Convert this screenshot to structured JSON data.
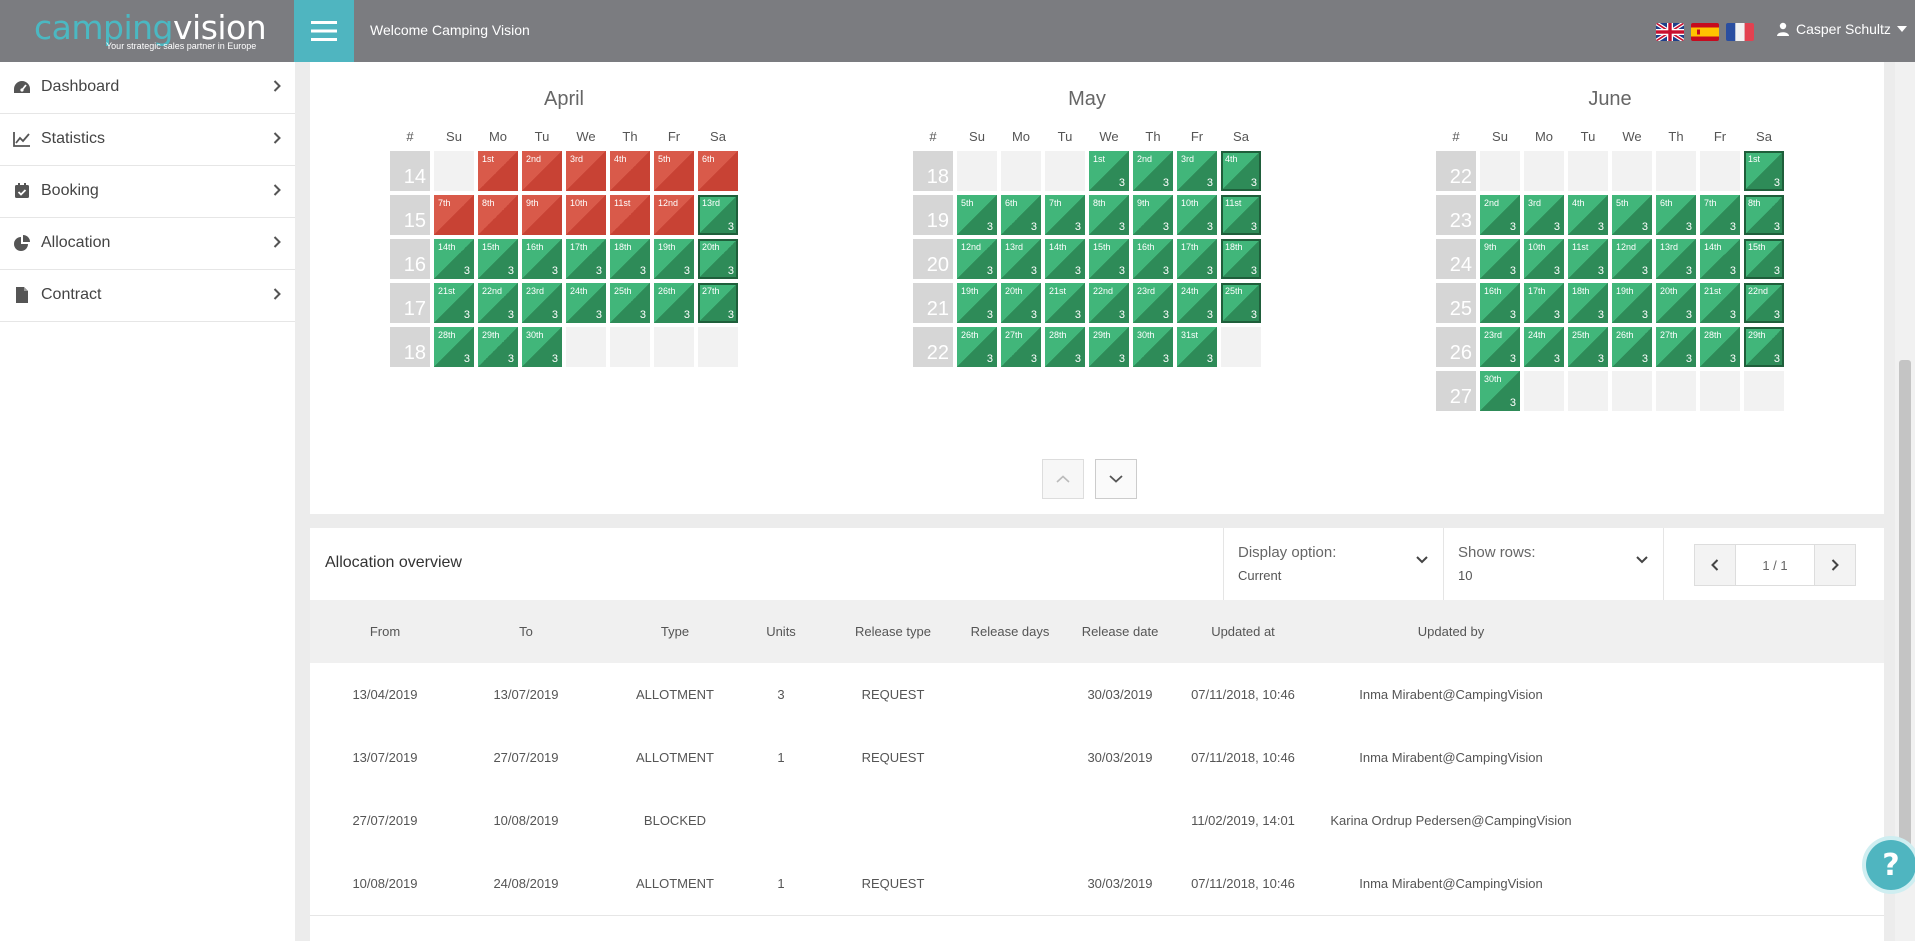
{
  "brand": {
    "name_part1": "camping",
    "name_part2": "vision",
    "tagline": "Your strategic sales partner in Europe"
  },
  "header": {
    "welcome": "Welcome Camping Vision",
    "user_name": "Casper Schultz",
    "flags": [
      "uk-flag",
      "spain-flag",
      "france-flag"
    ]
  },
  "sidebar": {
    "items": [
      {
        "label": "Dashboard",
        "icon": "dashboard-icon"
      },
      {
        "label": "Statistics",
        "icon": "chart-icon"
      },
      {
        "label": "Booking",
        "icon": "calendar-check-icon"
      },
      {
        "label": "Allocation",
        "icon": "pie-chart-icon"
      },
      {
        "label": "Contract",
        "icon": "file-icon"
      }
    ]
  },
  "calendar": {
    "weekday_labels": [
      "#",
      "Su",
      "Mo",
      "Tu",
      "We",
      "Th",
      "Fr",
      "Sa"
    ],
    "colors": {
      "available": "#41b67a",
      "unavailable": "#d95a4a",
      "empty": "#f2f2f2",
      "week": "#d6d6d6"
    },
    "months": [
      {
        "name": "April",
        "weeks": [
          {
            "num": "14",
            "days": [
              null,
              {
                "l": "1st",
                "s": "r"
              },
              {
                "l": "2nd",
                "s": "r"
              },
              {
                "l": "3rd",
                "s": "r"
              },
              {
                "l": "4th",
                "s": "r"
              },
              {
                "l": "5th",
                "s": "r"
              },
              {
                "l": "6th",
                "s": "r"
              }
            ]
          },
          {
            "num": "15",
            "days": [
              {
                "l": "7th",
                "s": "r"
              },
              {
                "l": "8th",
                "s": "r"
              },
              {
                "l": "9th",
                "s": "r"
              },
              {
                "l": "10th",
                "s": "r"
              },
              {
                "l": "11st",
                "s": "r"
              },
              {
                "l": "12nd",
                "s": "r"
              },
              {
                "l": "13rd",
                "s": "g",
                "u": "3"
              }
            ]
          },
          {
            "num": "16",
            "days": [
              {
                "l": "14th",
                "s": "g",
                "u": "3"
              },
              {
                "l": "15th",
                "s": "g",
                "u": "3"
              },
              {
                "l": "16th",
                "s": "g",
                "u": "3"
              },
              {
                "l": "17th",
                "s": "g",
                "u": "3"
              },
              {
                "l": "18th",
                "s": "g",
                "u": "3"
              },
              {
                "l": "19th",
                "s": "g",
                "u": "3"
              },
              {
                "l": "20th",
                "s": "g",
                "u": "3"
              }
            ]
          },
          {
            "num": "17",
            "days": [
              {
                "l": "21st",
                "s": "g",
                "u": "3"
              },
              {
                "l": "22nd",
                "s": "g",
                "u": "3"
              },
              {
                "l": "23rd",
                "s": "g",
                "u": "3"
              },
              {
                "l": "24th",
                "s": "g",
                "u": "3"
              },
              {
                "l": "25th",
                "s": "g",
                "u": "3"
              },
              {
                "l": "26th",
                "s": "g",
                "u": "3"
              },
              {
                "l": "27th",
                "s": "g",
                "u": "3"
              }
            ]
          },
          {
            "num": "18",
            "days": [
              {
                "l": "28th",
                "s": "g",
                "u": "3"
              },
              {
                "l": "29th",
                "s": "g",
                "u": "3"
              },
              {
                "l": "30th",
                "s": "g",
                "u": "3"
              },
              null,
              null,
              null,
              null
            ]
          }
        ]
      },
      {
        "name": "May",
        "weeks": [
          {
            "num": "18",
            "days": [
              null,
              null,
              null,
              {
                "l": "1st",
                "s": "g",
                "u": "3"
              },
              {
                "l": "2nd",
                "s": "g",
                "u": "3"
              },
              {
                "l": "3rd",
                "s": "g",
                "u": "3"
              },
              {
                "l": "4th",
                "s": "g",
                "u": "3"
              }
            ]
          },
          {
            "num": "19",
            "days": [
              {
                "l": "5th",
                "s": "g",
                "u": "3"
              },
              {
                "l": "6th",
                "s": "g",
                "u": "3"
              },
              {
                "l": "7th",
                "s": "g",
                "u": "3"
              },
              {
                "l": "8th",
                "s": "g",
                "u": "3"
              },
              {
                "l": "9th",
                "s": "g",
                "u": "3"
              },
              {
                "l": "10th",
                "s": "g",
                "u": "3"
              },
              {
                "l": "11st",
                "s": "g",
                "u": "3"
              }
            ]
          },
          {
            "num": "20",
            "days": [
              {
                "l": "12nd",
                "s": "g",
                "u": "3"
              },
              {
                "l": "13rd",
                "s": "g",
                "u": "3"
              },
              {
                "l": "14th",
                "s": "g",
                "u": "3"
              },
              {
                "l": "15th",
                "s": "g",
                "u": "3"
              },
              {
                "l": "16th",
                "s": "g",
                "u": "3"
              },
              {
                "l": "17th",
                "s": "g",
                "u": "3"
              },
              {
                "l": "18th",
                "s": "g",
                "u": "3"
              }
            ]
          },
          {
            "num": "21",
            "days": [
              {
                "l": "19th",
                "s": "g",
                "u": "3"
              },
              {
                "l": "20th",
                "s": "g",
                "u": "3"
              },
              {
                "l": "21st",
                "s": "g",
                "u": "3"
              },
              {
                "l": "22nd",
                "s": "g",
                "u": "3"
              },
              {
                "l": "23rd",
                "s": "g",
                "u": "3"
              },
              {
                "l": "24th",
                "s": "g",
                "u": "3"
              },
              {
                "l": "25th",
                "s": "g",
                "u": "3"
              }
            ]
          },
          {
            "num": "22",
            "days": [
              {
                "l": "26th",
                "s": "g",
                "u": "3"
              },
              {
                "l": "27th",
                "s": "g",
                "u": "3"
              },
              {
                "l": "28th",
                "s": "g",
                "u": "3"
              },
              {
                "l": "29th",
                "s": "g",
                "u": "3"
              },
              {
                "l": "30th",
                "s": "g",
                "u": "3"
              },
              {
                "l": "31st",
                "s": "g",
                "u": "3"
              },
              null
            ]
          }
        ]
      },
      {
        "name": "June",
        "weeks": [
          {
            "num": "22",
            "days": [
              null,
              null,
              null,
              null,
              null,
              null,
              {
                "l": "1st",
                "s": "g",
                "u": "3"
              }
            ]
          },
          {
            "num": "23",
            "days": [
              {
                "l": "2nd",
                "s": "g",
                "u": "3"
              },
              {
                "l": "3rd",
                "s": "g",
                "u": "3"
              },
              {
                "l": "4th",
                "s": "g",
                "u": "3"
              },
              {
                "l": "5th",
                "s": "g",
                "u": "3"
              },
              {
                "l": "6th",
                "s": "g",
                "u": "3"
              },
              {
                "l": "7th",
                "s": "g",
                "u": "3"
              },
              {
                "l": "8th",
                "s": "g",
                "u": "3"
              }
            ]
          },
          {
            "num": "24",
            "days": [
              {
                "l": "9th",
                "s": "g",
                "u": "3"
              },
              {
                "l": "10th",
                "s": "g",
                "u": "3"
              },
              {
                "l": "11st",
                "s": "g",
                "u": "3"
              },
              {
                "l": "12nd",
                "s": "g",
                "u": "3"
              },
              {
                "l": "13rd",
                "s": "g",
                "u": "3"
              },
              {
                "l": "14th",
                "s": "g",
                "u": "3"
              },
              {
                "l": "15th",
                "s": "g",
                "u": "3"
              }
            ]
          },
          {
            "num": "25",
            "days": [
              {
                "l": "16th",
                "s": "g",
                "u": "3"
              },
              {
                "l": "17th",
                "s": "g",
                "u": "3"
              },
              {
                "l": "18th",
                "s": "g",
                "u": "3"
              },
              {
                "l": "19th",
                "s": "g",
                "u": "3"
              },
              {
                "l": "20th",
                "s": "g",
                "u": "3"
              },
              {
                "l": "21st",
                "s": "g",
                "u": "3"
              },
              {
                "l": "22nd",
                "s": "g",
                "u": "3"
              }
            ]
          },
          {
            "num": "26",
            "days": [
              {
                "l": "23rd",
                "s": "g",
                "u": "3"
              },
              {
                "l": "24th",
                "s": "g",
                "u": "3"
              },
              {
                "l": "25th",
                "s": "g",
                "u": "3"
              },
              {
                "l": "26th",
                "s": "g",
                "u": "3"
              },
              {
                "l": "27th",
                "s": "g",
                "u": "3"
              },
              {
                "l": "28th",
                "s": "g",
                "u": "3"
              },
              {
                "l": "29th",
                "s": "g",
                "u": "3"
              }
            ]
          },
          {
            "num": "27",
            "days": [
              {
                "l": "30th",
                "s": "g",
                "u": "3"
              },
              null,
              null,
              null,
              null,
              null,
              null
            ]
          }
        ]
      }
    ]
  },
  "allocation": {
    "title": "Allocation overview",
    "display_option": {
      "label": "Display option:",
      "value": "Current"
    },
    "show_rows": {
      "label": "Show rows:",
      "value": "10"
    },
    "pager": "1 / 1",
    "columns": [
      "From",
      "To",
      "Type",
      "Units",
      "Release type",
      "Release days",
      "Release date",
      "Updated at",
      "Updated by"
    ],
    "rows": [
      [
        "13/04/2019",
        "13/07/2019",
        "ALLOTMENT",
        "3",
        "REQUEST",
        "",
        "30/03/2019",
        "07/11/2018, 10:46",
        "Inma Mirabent@CampingVision"
      ],
      [
        "13/07/2019",
        "27/07/2019",
        "ALLOTMENT",
        "1",
        "REQUEST",
        "",
        "30/03/2019",
        "07/11/2018, 10:46",
        "Inma Mirabent@CampingVision"
      ],
      [
        "27/07/2019",
        "10/08/2019",
        "BLOCKED",
        "",
        "",
        "",
        "",
        "11/02/2019, 14:01",
        "Karina Ordrup Pedersen@CampingVision"
      ],
      [
        "10/08/2019",
        "24/08/2019",
        "ALLOTMENT",
        "1",
        "REQUEST",
        "",
        "30/03/2019",
        "07/11/2018, 10:46",
        "Inma Mirabent@CampingVision"
      ]
    ]
  },
  "help": {
    "label": "?"
  }
}
